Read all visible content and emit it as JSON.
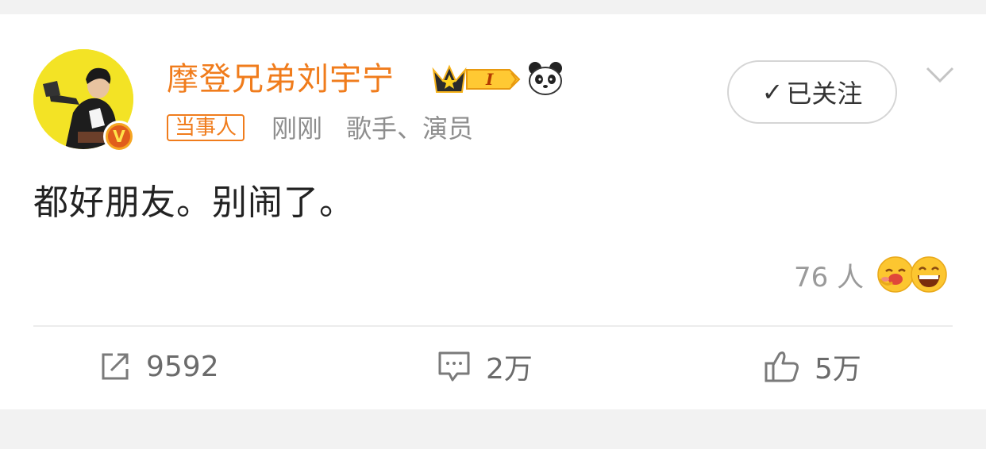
{
  "post": {
    "username": "摩登兄弟刘宇宁",
    "tag": "当事人",
    "time": "刚刚",
    "description": "歌手、演员",
    "content": "都好朋友。别闹了。",
    "follow_check": "✓",
    "follow_label": "已关注",
    "level_badge": "I"
  },
  "reactions": {
    "count": "76 人"
  },
  "actions": {
    "repost": "9592",
    "comment": "2万",
    "like": "5万"
  },
  "colors": {
    "username": "#f07c1c",
    "meta": "#8e8e8e",
    "background": "#f2f2f2"
  }
}
